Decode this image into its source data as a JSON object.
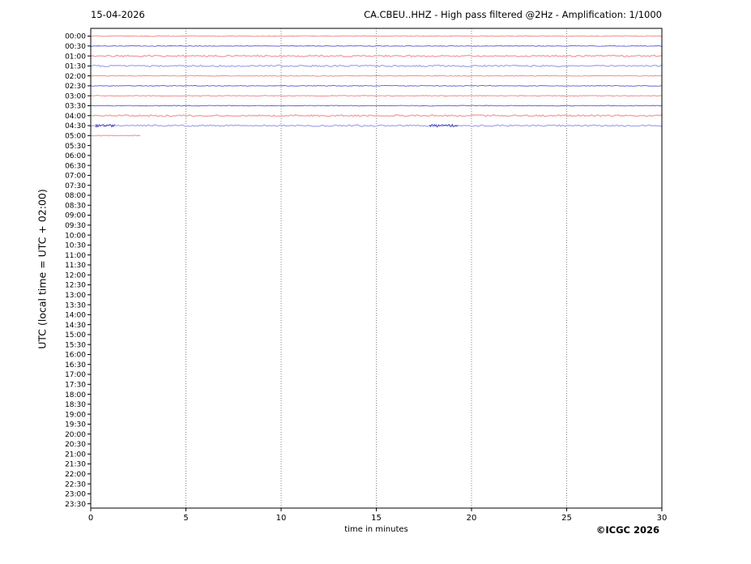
{
  "header": {
    "date": "15-04-2026",
    "title": "CA.CBEU..HHZ - High pass filtered @2Hz - Amplification: 1/1000"
  },
  "axes": {
    "ylabel": "UTC (local time = UTC + 02:00)",
    "xlabel": "time in minutes"
  },
  "footer": {
    "copyright": "©ICGC 2026"
  },
  "chart_data": {
    "type": "line",
    "subtype": "helicorder-seismogram",
    "title": "CA.CBEU..HHZ - High pass filtered @2Hz - Amplification: 1/1000",
    "date": "15-04-2026",
    "xlabel": "time in minutes",
    "ylabel": "UTC (local time = UTC + 02:00)",
    "xlim": [
      0,
      30
    ],
    "xticks": [
      0,
      5,
      10,
      15,
      20,
      25,
      30
    ],
    "grid": "vertical dotted lines at interior 5-minute ticks",
    "legend": "none",
    "row_labels": [
      "00:00",
      "00:30",
      "01:00",
      "01:30",
      "02:00",
      "02:30",
      "03:00",
      "03:30",
      "04:00",
      "04:30",
      "05:00",
      "05:30",
      "06:00",
      "06:30",
      "07:00",
      "07:30",
      "08:00",
      "08:30",
      "09:00",
      "09:30",
      "10:00",
      "10:30",
      "11:00",
      "11:30",
      "12:00",
      "12:30",
      "13:00",
      "13:30",
      "14:00",
      "14:30",
      "15:00",
      "15:30",
      "16:00",
      "16:30",
      "17:00",
      "17:30",
      "18:00",
      "18:30",
      "19:00",
      "19:30",
      "20:00",
      "20:30",
      "21:00",
      "21:30",
      "22:00",
      "22:30",
      "23:00",
      "23:30"
    ],
    "colors": {
      "red": "#f08080",
      "red_light": "#f5a5a5",
      "blue": "#5a5ad0",
      "blue_light": "#aeaeef",
      "burst": "#4343bd",
      "grid": "#666666",
      "frame": "#000000"
    },
    "traces": [
      {
        "row_label": "00:00",
        "row_index": 0,
        "color_key": "red",
        "style": "crisp",
        "start_min": 0,
        "end_min": 30
      },
      {
        "row_label": "00:30",
        "row_index": 1,
        "color_key": "blue",
        "style": "crisp",
        "start_min": 0,
        "end_min": 30
      },
      {
        "row_label": "01:00",
        "row_index": 2,
        "color_key": "red_light",
        "style": "fuzzy",
        "start_min": 0,
        "end_min": 30
      },
      {
        "row_label": "01:30",
        "row_index": 3,
        "color_key": "blue_light",
        "style": "fuzzy",
        "start_min": 0,
        "end_min": 30
      },
      {
        "row_label": "02:00",
        "row_index": 4,
        "color_key": "red",
        "style": "crisp",
        "start_min": 0,
        "end_min": 30
      },
      {
        "row_label": "02:30",
        "row_index": 5,
        "color_key": "blue",
        "style": "crisp",
        "start_min": 0,
        "end_min": 30
      },
      {
        "row_label": "03:00",
        "row_index": 6,
        "color_key": "red",
        "style": "crisp",
        "start_min": 0,
        "end_min": 30
      },
      {
        "row_label": "03:30",
        "row_index": 7,
        "color_key": "blue",
        "style": "crisp",
        "start_min": 0,
        "end_min": 30
      },
      {
        "row_label": "04:00",
        "row_index": 8,
        "color_key": "red_light",
        "style": "fuzzy",
        "start_min": 0,
        "end_min": 30
      },
      {
        "row_label": "04:30",
        "row_index": 9,
        "color_key": "blue_light",
        "style": "fuzzy",
        "start_min": 0,
        "end_min": 30,
        "bursts_min": [
          [
            0.25,
            1.3
          ],
          [
            17.8,
            19.3
          ]
        ]
      },
      {
        "row_label": "05:00",
        "row_index": 10,
        "color_key": "red",
        "style": "crisp",
        "start_min": 0,
        "end_min": 2.6
      }
    ],
    "empty_rows": "05:30 through 23:30 contain no trace data"
  }
}
